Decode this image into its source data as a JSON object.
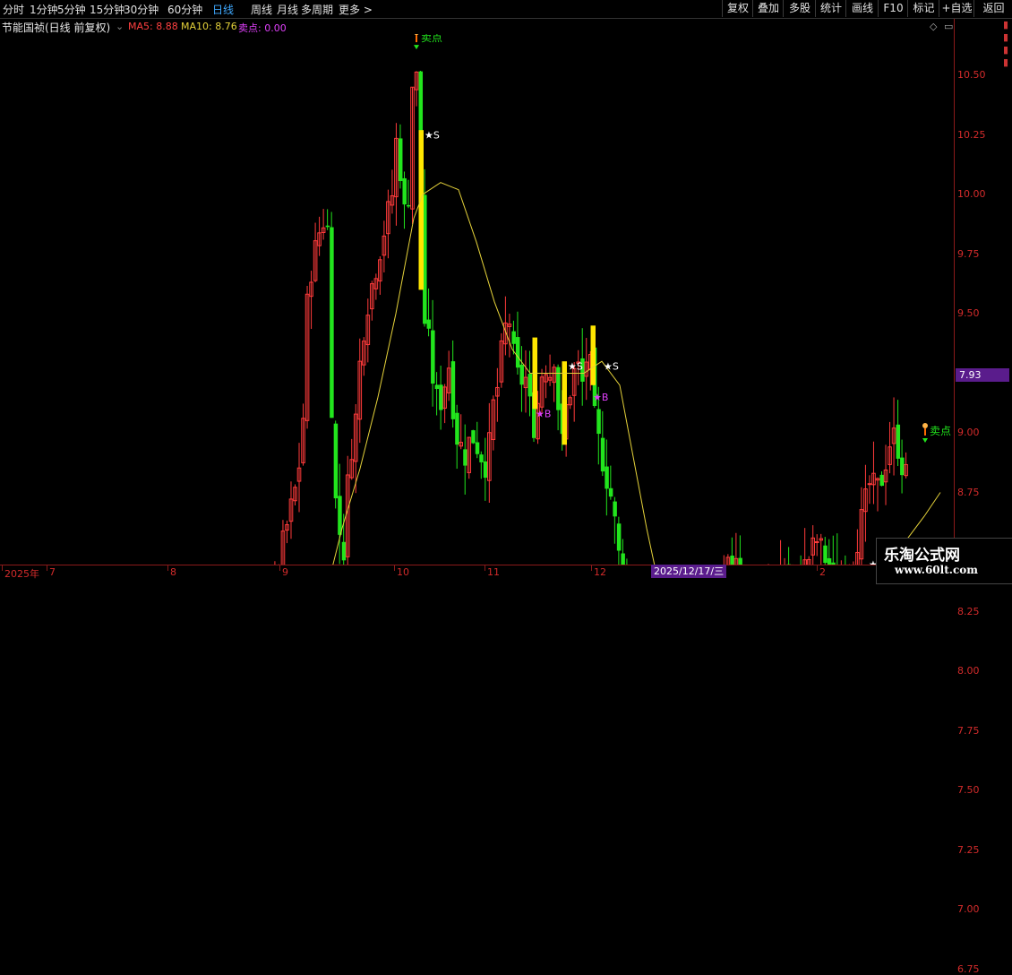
{
  "toolbar": {
    "periods": [
      "分时",
      "1分钟",
      "5分钟",
      "15分钟",
      "30分钟",
      "60分钟",
      "日线",
      "周线",
      "月线",
      "多周期",
      "更多 >"
    ],
    "active_period": "日线",
    "buttons": [
      "复权",
      "叠加",
      "多股",
      "统计",
      "画线",
      "F10",
      "标记",
      "+自选",
      "返回"
    ]
  },
  "info": {
    "title": "节能国祯(日线 前复权)",
    "ma5_label": "MA5: 8.88",
    "ma10_label": "MA10: 8.76",
    "sell_label": "卖点: 0.00"
  },
  "y_axis": {
    "ticks": [
      "10.50",
      "10.25",
      "10.00",
      "9.75",
      "9.50",
      "9.25",
      "9.00",
      "8.75",
      "8.50",
      "8.25",
      "8.00",
      "7.75",
      "7.50",
      "7.25",
      "7.00",
      "6.75"
    ],
    "current_price": "7.93"
  },
  "x_axis": {
    "labels": [
      "2025年",
      "7",
      "8",
      "9",
      "10",
      "11",
      "12",
      "2"
    ],
    "cursor_date": "2025/12/17/三"
  },
  "signals": {
    "sell_point": "卖点",
    "buy": "★B",
    "sell": "★S"
  },
  "watermark": {
    "line1": "乐淘公式网",
    "line2": "www.60lt.com"
  },
  "colors": {
    "up": "#ff3b3b",
    "down": "#22e51d",
    "ma": "#e5d23a",
    "highlight": "#ffe600",
    "buy": "#e040fb",
    "sell_text": "#ffffff"
  },
  "chart_data": {
    "type": "candlestick",
    "ylim": [
      6.6,
      10.85
    ],
    "x_count": 232,
    "path_x": [
      0,
      10,
      20,
      30,
      40,
      50,
      60,
      70,
      80,
      90,
      95,
      100,
      110,
      120,
      128,
      135,
      142,
      148,
      155,
      160,
      168,
      176,
      184,
      192,
      200,
      208,
      212,
      216,
      220,
      226,
      232,
      240,
      248,
      256,
      264,
      270,
      276,
      282,
      288,
      294,
      300,
      306,
      312,
      318,
      324,
      330,
      336,
      340,
      346,
      352,
      358,
      364,
      370,
      376,
      382,
      388,
      394,
      400,
      406,
      412,
      418,
      424,
      430,
      436,
      442,
      448,
      454,
      458,
      462,
      466,
      470,
      476,
      482,
      488,
      494,
      500,
      506,
      512,
      518,
      524,
      530,
      536,
      542,
      548,
      554,
      560,
      566,
      572,
      578,
      584,
      590,
      596,
      600,
      606,
      612,
      618,
      624,
      630,
      636,
      642,
      648,
      652,
      656,
      660,
      664,
      670,
      676,
      682,
      688,
      694,
      700,
      706,
      712,
      718,
      724,
      730,
      736,
      742,
      748,
      754,
      760,
      766,
      772,
      778,
      784,
      790,
      796,
      802,
      808,
      814,
      820,
      826,
      832,
      838,
      844,
      850,
      856,
      862,
      868,
      874,
      880,
      886,
      892,
      898,
      904,
      910,
      916,
      922,
      928,
      934,
      940,
      946,
      952,
      958,
      964,
      970,
      976,
      982,
      988,
      994,
      1000,
      1006,
      1012,
      1018,
      1024,
      1030,
      1036,
      1042,
      1048
    ],
    "path_y": [
      6.8,
      6.85,
      6.88,
      6.95,
      7.05,
      7.12,
      7.2,
      7.3,
      7.5,
      7.45,
      7.4,
      7.35,
      7.3,
      7.32,
      7.3,
      7.33,
      7.2,
      7.15,
      7.12,
      7.18,
      7.35,
      7.45,
      7.6,
      7.55,
      7.65,
      7.7,
      7.55,
      7.6,
      7.62,
      7.58,
      7.6,
      7.55,
      7.5,
      7.48,
      7.45,
      7.55,
      7.65,
      7.7,
      7.8,
      7.78,
      7.85,
      8.4,
      8.5,
      8.6,
      8.7,
      8.8,
      9.0,
      9.5,
      9.7,
      9.8,
      9.9,
      9.85,
      8.8,
      8.6,
      8.5,
      8.9,
      9.0,
      9.3,
      9.5,
      9.6,
      9.7,
      9.8,
      9.9,
      10.0,
      10.3,
      9.9,
      10.0,
      10.45,
      10.55,
      10.3,
      9.5,
      9.4,
      9.2,
      9.1,
      9.2,
      9.3,
      9.0,
      8.95,
      8.9,
      9.0,
      8.95,
      8.9,
      8.85,
      9.1,
      9.2,
      9.4,
      9.5,
      9.3,
      9.2,
      9.25,
      9.1,
      9.0,
      9.2,
      9.3,
      9.25,
      9.35,
      8.9,
      9.1,
      9.2,
      9.3,
      9.2,
      9.3,
      9.35,
      9.1,
      9.0,
      8.9,
      8.8,
      8.7,
      8.5,
      8.4,
      8.3,
      8.25,
      8.2,
      8.25,
      8.3,
      8.2,
      8.25,
      8.2,
      8.1,
      8.0,
      7.95,
      8.0,
      8.1,
      8.15,
      8.2,
      8.25,
      8.3,
      8.35,
      8.4,
      8.45,
      8.5,
      8.4,
      8.35,
      8.3,
      8.25,
      8.2,
      8.3,
      8.35,
      8.4,
      8.45,
      8.4,
      8.35,
      8.4,
      8.45,
      8.5,
      8.55,
      8.5,
      8.45,
      8.4,
      8.35,
      8.4,
      8.45,
      8.5,
      8.6,
      8.7,
      8.8,
      8.75,
      8.8,
      8.9,
      9.0,
      8.95,
      8.85,
      8.8
    ],
    "ma10": [
      [
        0,
        6.8
      ],
      [
        40,
        6.95
      ],
      [
        90,
        7.15
      ],
      [
        120,
        7.3
      ],
      [
        150,
        7.33
      ],
      [
        200,
        7.35
      ],
      [
        215,
        7.3
      ],
      [
        240,
        7.5
      ],
      [
        270,
        7.62
      ],
      [
        300,
        7.65
      ],
      [
        330,
        7.7
      ],
      [
        340,
        7.95
      ],
      [
        360,
        8.3
      ],
      [
        380,
        8.6
      ],
      [
        400,
        8.85
      ],
      [
        420,
        9.15
      ],
      [
        440,
        9.5
      ],
      [
        460,
        9.9
      ],
      [
        470,
        10.0
      ],
      [
        490,
        10.05
      ],
      [
        510,
        10.02
      ],
      [
        530,
        9.8
      ],
      [
        550,
        9.55
      ],
      [
        570,
        9.35
      ],
      [
        590,
        9.25
      ],
      [
        620,
        9.25
      ],
      [
        650,
        9.25
      ],
      [
        670,
        9.3
      ],
      [
        690,
        9.2
      ],
      [
        700,
        9.0
      ],
      [
        720,
        8.6
      ],
      [
        740,
        8.25
      ],
      [
        760,
        8.05
      ],
      [
        790,
        7.9
      ],
      [
        810,
        7.85
      ],
      [
        830,
        7.9
      ],
      [
        860,
        8.05
      ],
      [
        890,
        8.15
      ],
      [
        920,
        8.25
      ],
      [
        950,
        8.3
      ],
      [
        980,
        8.38
      ],
      [
        1010,
        8.55
      ],
      [
        1030,
        8.65
      ],
      [
        1048,
        8.75
      ]
    ],
    "highlighted": [
      {
        "x": 4,
        "o": 6.7,
        "c": 6.85
      },
      {
        "x": 20,
        "o": 6.75,
        "c": 6.85
      },
      {
        "x": 92,
        "o": 7.3,
        "c": 7.4
      },
      {
        "x": 150,
        "o": 7.28,
        "c": 7.33
      },
      {
        "x": 215,
        "o": 7.2,
        "c": 7.8
      },
      {
        "x": 276,
        "o": 7.65,
        "c": 7.72
      },
      {
        "x": 330,
        "o": 7.6,
        "c": 7.95
      },
      {
        "x": 468,
        "o": 10.27,
        "c": 9.6
      },
      {
        "x": 595,
        "o": 9.4,
        "c": 9.1
      },
      {
        "x": 628,
        "o": 9.3,
        "c": 8.95
      },
      {
        "x": 660,
        "o": 9.45,
        "c": 9.2
      },
      {
        "x": 790,
        "o": 7.95,
        "c": 8.02
      },
      {
        "x": 972,
        "o": 8.35,
        "c": 8.3
      }
    ],
    "sell_points": [
      {
        "x": 92,
        "price": 7.55
      },
      {
        "x": 465,
        "price": 10.65
      },
      {
        "x": 1033,
        "price": 9.0
      }
    ],
    "buy_marks": [
      {
        "x": 26,
        "price": 6.78
      },
      {
        "x": 222,
        "price": 7.15
      },
      {
        "x": 340,
        "price": 7.72
      },
      {
        "x": 602,
        "price": 9.08
      },
      {
        "x": 666,
        "price": 9.15
      },
      {
        "x": 796,
        "price": 7.93
      },
      {
        "x": 980,
        "price": 8.28
      }
    ],
    "sell_marks": [
      {
        "x": 8,
        "price": 6.88
      },
      {
        "x": 158,
        "price": 7.32
      },
      {
        "x": 282,
        "price": 7.72
      },
      {
        "x": 478,
        "price": 10.25
      },
      {
        "x": 638,
        "price": 9.28
      },
      {
        "x": 678,
        "price": 9.28
      },
      {
        "x": 974,
        "price": 8.45
      }
    ]
  }
}
